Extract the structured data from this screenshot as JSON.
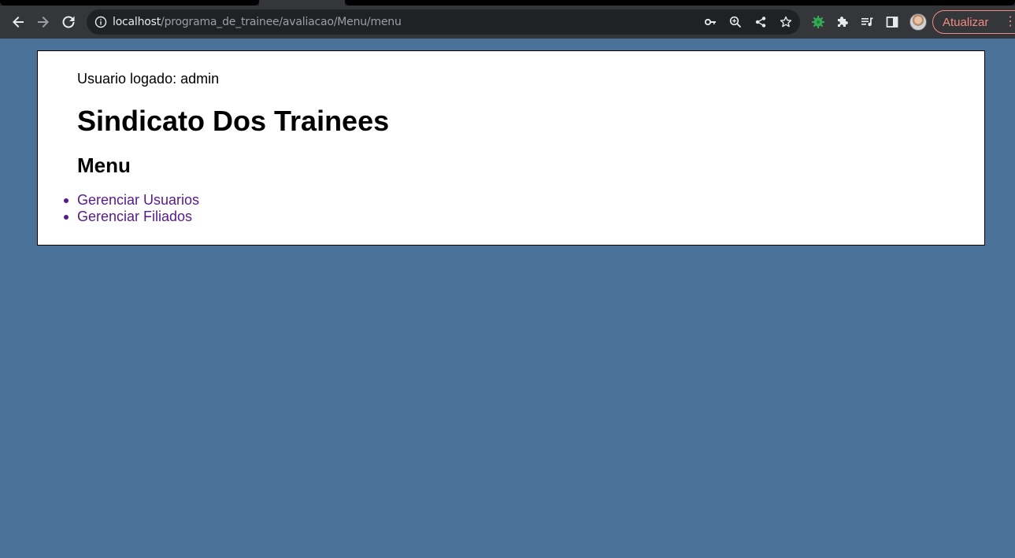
{
  "browser": {
    "url_host": "localhost",
    "url_path": "/programa_de_trainee/avaliacao/Menu/menu",
    "update_label": "Atualizar",
    "icons": [
      "back-icon",
      "forward-icon",
      "reload-icon",
      "info-icon",
      "key-icon",
      "zoom-icon",
      "share-icon",
      "star-icon",
      "extension-bug-icon",
      "puzzle-icon",
      "media-icon",
      "sidepanel-icon",
      "avatar",
      "more-icon"
    ]
  },
  "page": {
    "logged_user": "Usuario logado: admin",
    "title": "Sindicato Dos Trainees",
    "menu_heading": "Menu",
    "menu_items": [
      {
        "label": "Gerenciar Usuarios"
      },
      {
        "label": "Gerenciar Filiados"
      }
    ],
    "link_color": "#551a8b",
    "background_color": "#4b7298"
  }
}
